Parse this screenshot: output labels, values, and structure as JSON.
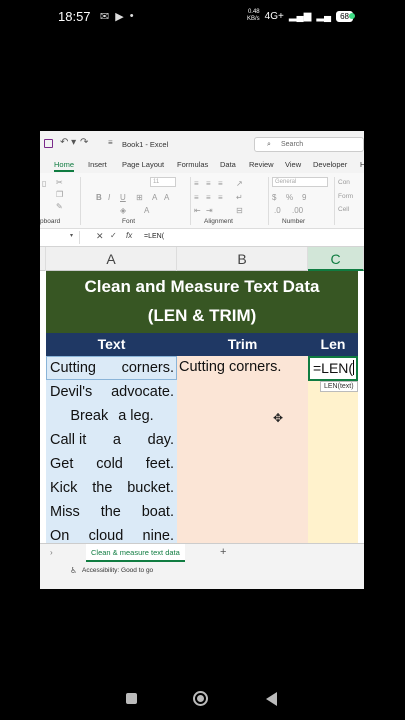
{
  "status_bar": {
    "time": "18:57",
    "speed_value": "0.48",
    "speed_unit": "KB/s",
    "network": "4G+",
    "battery": "68"
  },
  "excel": {
    "window_title": "Book1 - Excel",
    "search_placeholder": "Search",
    "ribbon_tabs": [
      "Home",
      "Insert",
      "Page Layout",
      "Formulas",
      "Data",
      "Review",
      "View",
      "Developer",
      "H"
    ],
    "active_tab": "Home",
    "groups": {
      "clipboard": "pboard",
      "font": "Font",
      "alignment": "Alignment",
      "number": "Number"
    },
    "font_size": "11",
    "number_format": "General",
    "styles_fragments": [
      "Con",
      "Form",
      "Cell"
    ],
    "formula_bar": {
      "fx": "fx",
      "content": "=LEN("
    },
    "columns": [
      "A",
      "B",
      "C"
    ],
    "selected_column": "C",
    "sheet": {
      "title_line1": "Clean and Measure Text Data",
      "title_line2": "(LEN & TRIM)",
      "headers": {
        "text": "Text",
        "trim": "Trim",
        "len": "Len"
      },
      "b1_value": "Cutting corners.",
      "c1_editing": "=LEN(",
      "tooltip": "LEN(text)",
      "rows": [
        {
          "words": [
            "Cutting",
            "corners."
          ]
        },
        {
          "words": [
            "Devil's",
            "advocate."
          ]
        },
        {
          "words": [
            "Break",
            "a leg."
          ]
        },
        {
          "words": [
            "Call it",
            "a",
            "day."
          ]
        },
        {
          "words": [
            "Get",
            "cold",
            "feet."
          ]
        },
        {
          "words": [
            "Kick",
            "the",
            "bucket."
          ]
        },
        {
          "words": [
            "Miss",
            "the",
            "boat."
          ]
        },
        {
          "words": [
            "On",
            "cloud",
            "nine."
          ]
        }
      ]
    },
    "sheet_tab": "Clean & measure text data",
    "accessibility": "Accessibility: Good to go"
  }
}
